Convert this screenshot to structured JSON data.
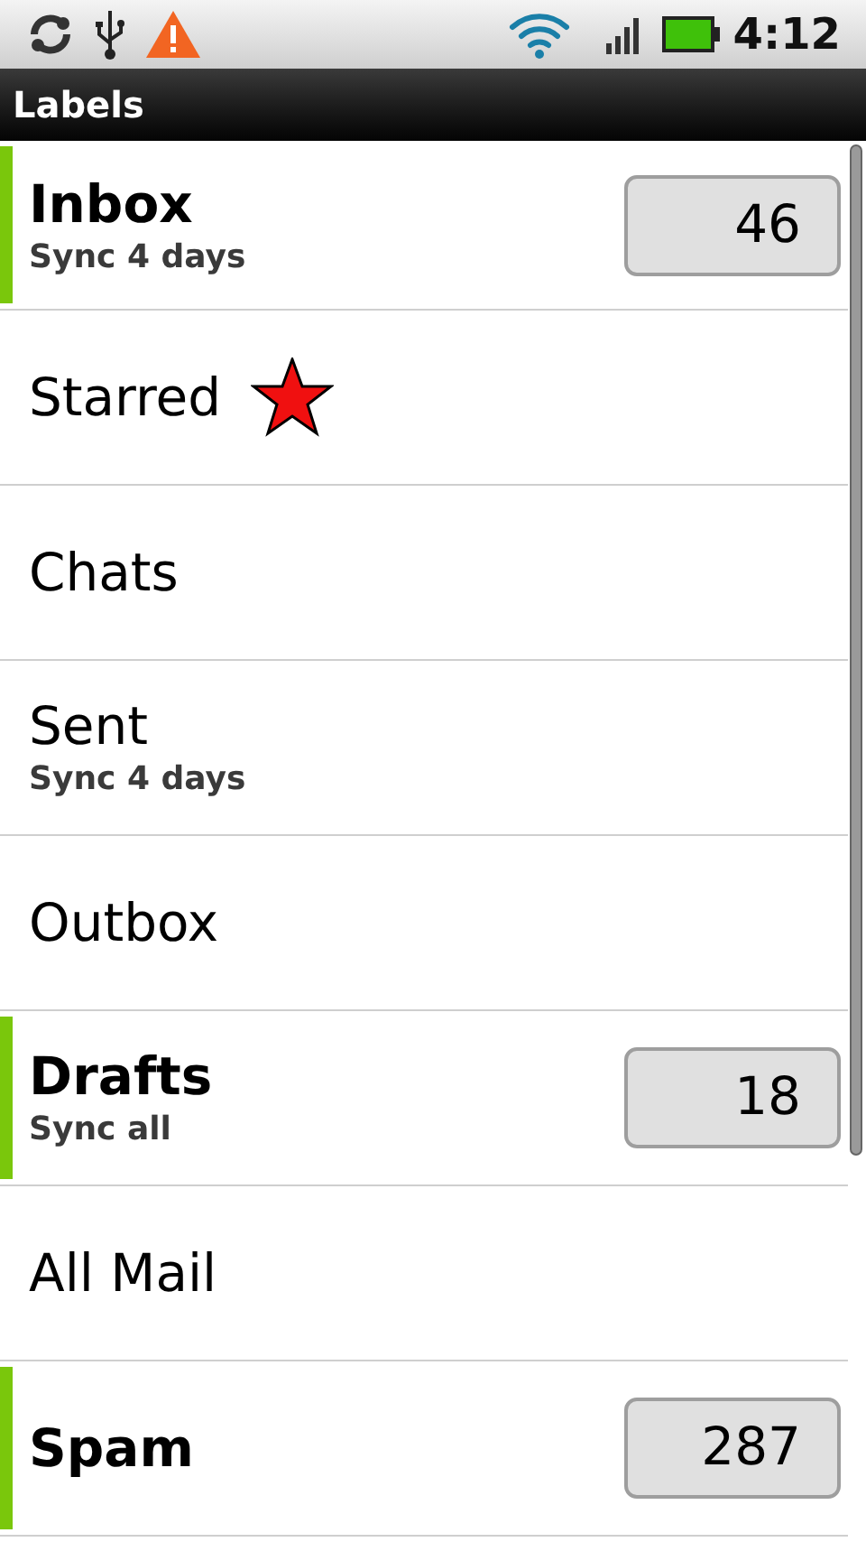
{
  "status_bar": {
    "time": "4:12"
  },
  "title_bar": {
    "title": "Labels"
  },
  "labels": [
    {
      "name": "Inbox",
      "kind": "label",
      "synced": true,
      "sync": "Sync 4 days",
      "count": "46"
    },
    {
      "name": "Starred",
      "kind": "star",
      "synced": false
    },
    {
      "name": "Chats",
      "kind": "label",
      "synced": false
    },
    {
      "name": "Sent",
      "kind": "label",
      "synced": false,
      "sync": "Sync 4 days"
    },
    {
      "name": "Outbox",
      "kind": "label",
      "synced": false
    },
    {
      "name": "Drafts",
      "kind": "label",
      "synced": true,
      "sync": "Sync all",
      "count": "18"
    },
    {
      "name": "All Mail",
      "kind": "label",
      "synced": false
    },
    {
      "name": "Spam",
      "kind": "label",
      "synced": true,
      "count": "287"
    }
  ]
}
